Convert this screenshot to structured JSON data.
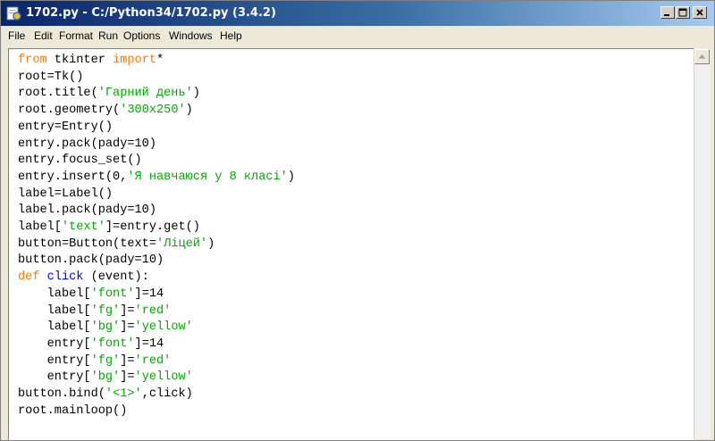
{
  "window": {
    "title": "1702.py - C:/Python34/1702.py (3.4.2)"
  },
  "menu": [
    "File",
    "Edit",
    "Format",
    "Run",
    "Options",
    "Windows",
    "Help"
  ],
  "code": {
    "l1": {
      "a": "from",
      "b": " tkinter ",
      "c": "import",
      "d": "*"
    },
    "l2": "root=Tk()",
    "l3": {
      "a": "root.title(",
      "b": "'Гарний день'",
      "c": ")"
    },
    "l4": {
      "a": "root.geometry(",
      "b": "'300x250'",
      "c": ")"
    },
    "l5": "entry=Entry()",
    "l6": "entry.pack(pady=10)",
    "l7": "entry.focus_set()",
    "l8": {
      "a": "entry.insert(0,",
      "b": "'Я навчаюся у 8 класі'",
      "c": ")"
    },
    "l9": "label=Label()",
    "l10": "label.pack(pady=10)",
    "l11": {
      "a": "label[",
      "b": "'text'",
      "c": "]=entry.get()"
    },
    "l12": {
      "a": "button=Button(text=",
      "b": "'Ліцей'",
      "c": ")"
    },
    "l13": "button.pack(pady=10)",
    "l14": {
      "a": "def",
      "b": " ",
      "c": "click",
      "d": " (event):"
    },
    "l15": {
      "a": "    label[",
      "b": "'font'",
      "c": "]=14"
    },
    "l16": {
      "a": "    label[",
      "b": "'fg'",
      "c": "]=",
      "d": "'red'"
    },
    "l17": {
      "a": "    label[",
      "b": "'bg'",
      "c": "]=",
      "d": "'yellow'"
    },
    "l18": {
      "a": "    entry[",
      "b": "'font'",
      "c": "]=14"
    },
    "l19": {
      "a": "    entry[",
      "b": "'fg'",
      "c": "]=",
      "d": "'red'"
    },
    "l20": {
      "a": "    entry[",
      "b": "'bg'",
      "c": "]=",
      "d": "'yellow'"
    },
    "l21": {
      "a": "button.bind(",
      "b": "'<1>'",
      "c": ",click)"
    },
    "l22": "root.mainloop()"
  },
  "colors": {
    "keyword": "#ff7700",
    "string": "#00aa00",
    "definition": "#0000ff"
  },
  "icons": {
    "app": "python-idle-icon",
    "minimize": "minimize-icon",
    "maximize": "maximize-icon",
    "close": "close-icon",
    "scroll_up": "arrow-up-icon"
  }
}
